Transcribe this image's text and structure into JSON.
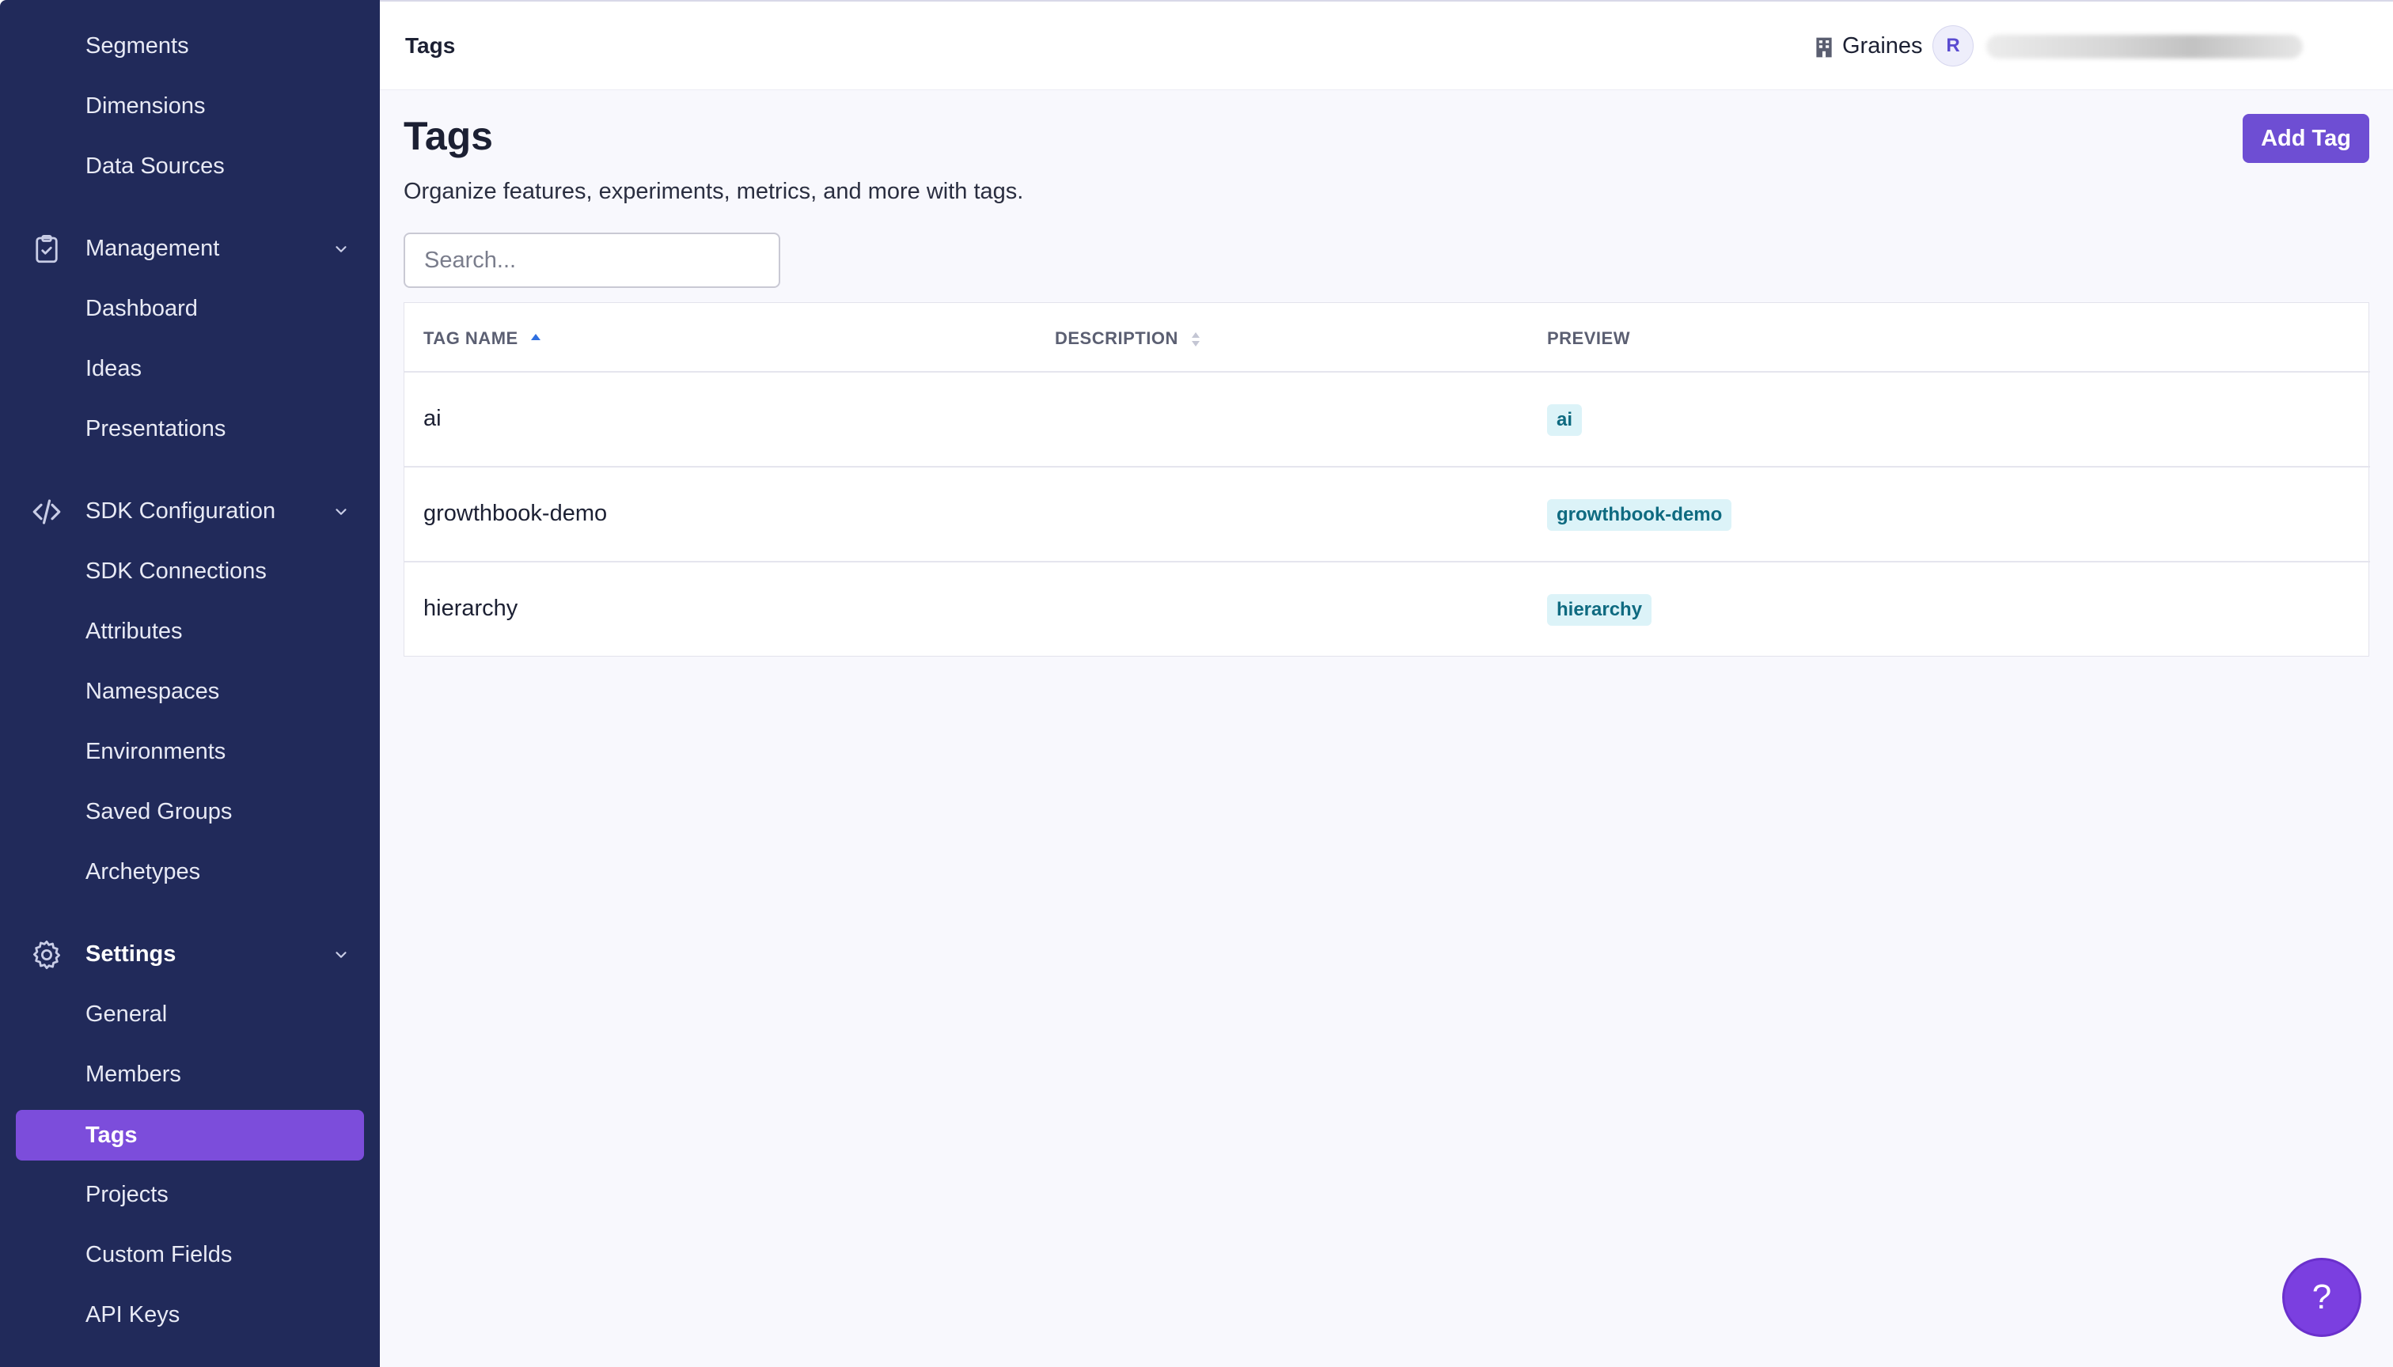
{
  "sidebar": {
    "top_items": [
      {
        "label": "Segments"
      },
      {
        "label": "Dimensions"
      },
      {
        "label": "Data Sources"
      }
    ],
    "management": {
      "label": "Management",
      "items": [
        {
          "label": "Dashboard"
        },
        {
          "label": "Ideas"
        },
        {
          "label": "Presentations"
        }
      ]
    },
    "sdk": {
      "label": "SDK Configuration",
      "items": [
        {
          "label": "SDK Connections"
        },
        {
          "label": "Attributes"
        },
        {
          "label": "Namespaces"
        },
        {
          "label": "Environments"
        },
        {
          "label": "Saved Groups"
        },
        {
          "label": "Archetypes"
        }
      ]
    },
    "settings": {
      "label": "Settings",
      "items": [
        {
          "label": "General"
        },
        {
          "label": "Members"
        },
        {
          "label": "Tags"
        },
        {
          "label": "Projects"
        },
        {
          "label": "Custom Fields"
        },
        {
          "label": "API Keys"
        }
      ]
    },
    "colors": {
      "background": "#212a5a",
      "active": "#7c4ddb"
    }
  },
  "topbar": {
    "title": "Tags",
    "org_name": "Graines",
    "avatar_initial": "R"
  },
  "page": {
    "title": "Tags",
    "description": "Organize features, experiments, metrics, and more with tags.",
    "add_button": "Add Tag",
    "search_placeholder": "Search..."
  },
  "table": {
    "columns": [
      {
        "label": "TAG NAME",
        "sort": "asc"
      },
      {
        "label": "DESCRIPTION",
        "sort": "none"
      },
      {
        "label": "PREVIEW"
      }
    ],
    "rows": [
      {
        "name": "ai",
        "description": "",
        "preview": "ai"
      },
      {
        "name": "growthbook-demo",
        "description": "",
        "preview": "growthbook-demo"
      },
      {
        "name": "hierarchy",
        "description": "",
        "preview": "hierarchy"
      }
    ]
  },
  "help": {
    "label": "?"
  }
}
